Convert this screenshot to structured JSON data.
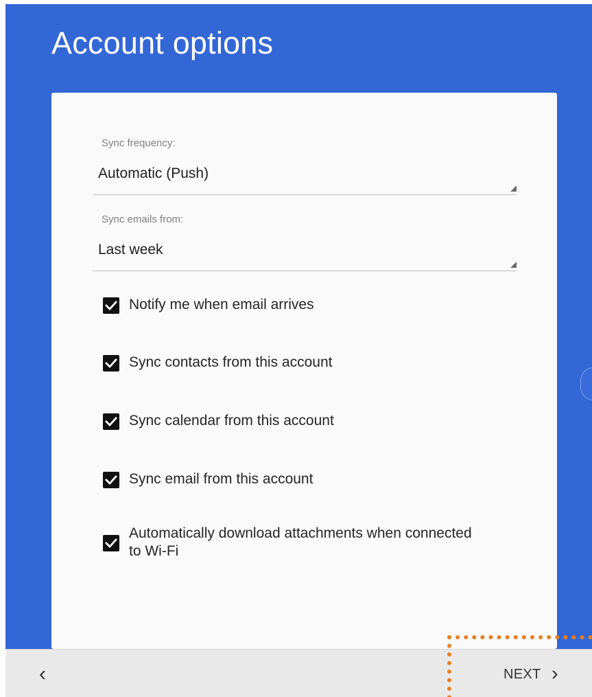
{
  "page": {
    "title": "Account options"
  },
  "form": {
    "sync_frequency": {
      "label": "Sync frequency:",
      "value": "Automatic (Push)"
    },
    "sync_emails_from": {
      "label": "Sync emails from:",
      "value": "Last week"
    },
    "options": [
      {
        "label": "Notify me when email arrives",
        "checked": true
      },
      {
        "label": "Sync contacts from this account",
        "checked": true
      },
      {
        "label": "Sync calendar from this account",
        "checked": true
      },
      {
        "label": "Sync email from this account",
        "checked": true
      },
      {
        "label": "Automatically download attachments when connected to Wi-Fi",
        "checked": true
      }
    ]
  },
  "navigation": {
    "back_icon": "chevron-left-icon",
    "next_label": "NEXT",
    "next_icon": "chevron-right-icon"
  },
  "colors": {
    "header_blue": "#3467d6",
    "card_background": "#fafafa",
    "checkbox": "#111111",
    "bottom_bar": "#e9e9e9",
    "highlight": "#ea7e1f"
  }
}
